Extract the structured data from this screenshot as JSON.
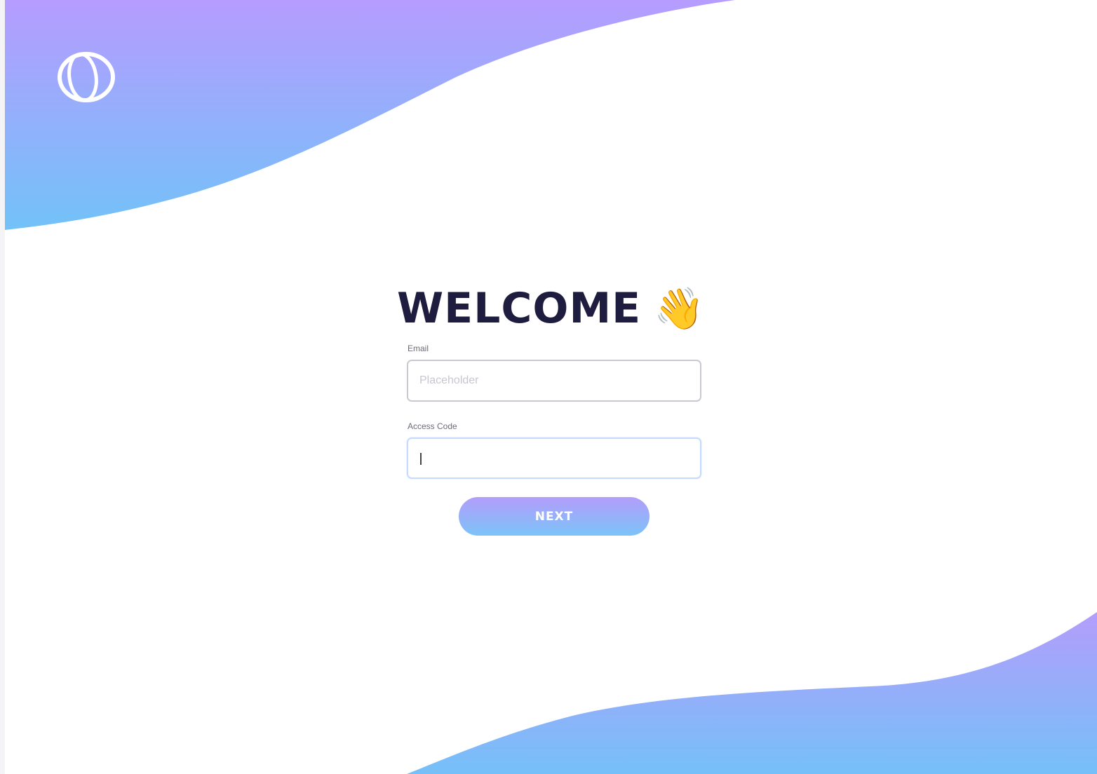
{
  "brand": {
    "logo_icon": "ring-logo-icon",
    "gradient_start": "#b69cff",
    "gradient_end": "#72c2f8"
  },
  "login": {
    "title": "WELCOME",
    "title_emoji": "👋",
    "email_label": "Email",
    "email_placeholder": "Placeholder",
    "email_value": "",
    "access_code_label": "Access Code",
    "access_code_value": "",
    "next_button_label": "NEXT"
  }
}
